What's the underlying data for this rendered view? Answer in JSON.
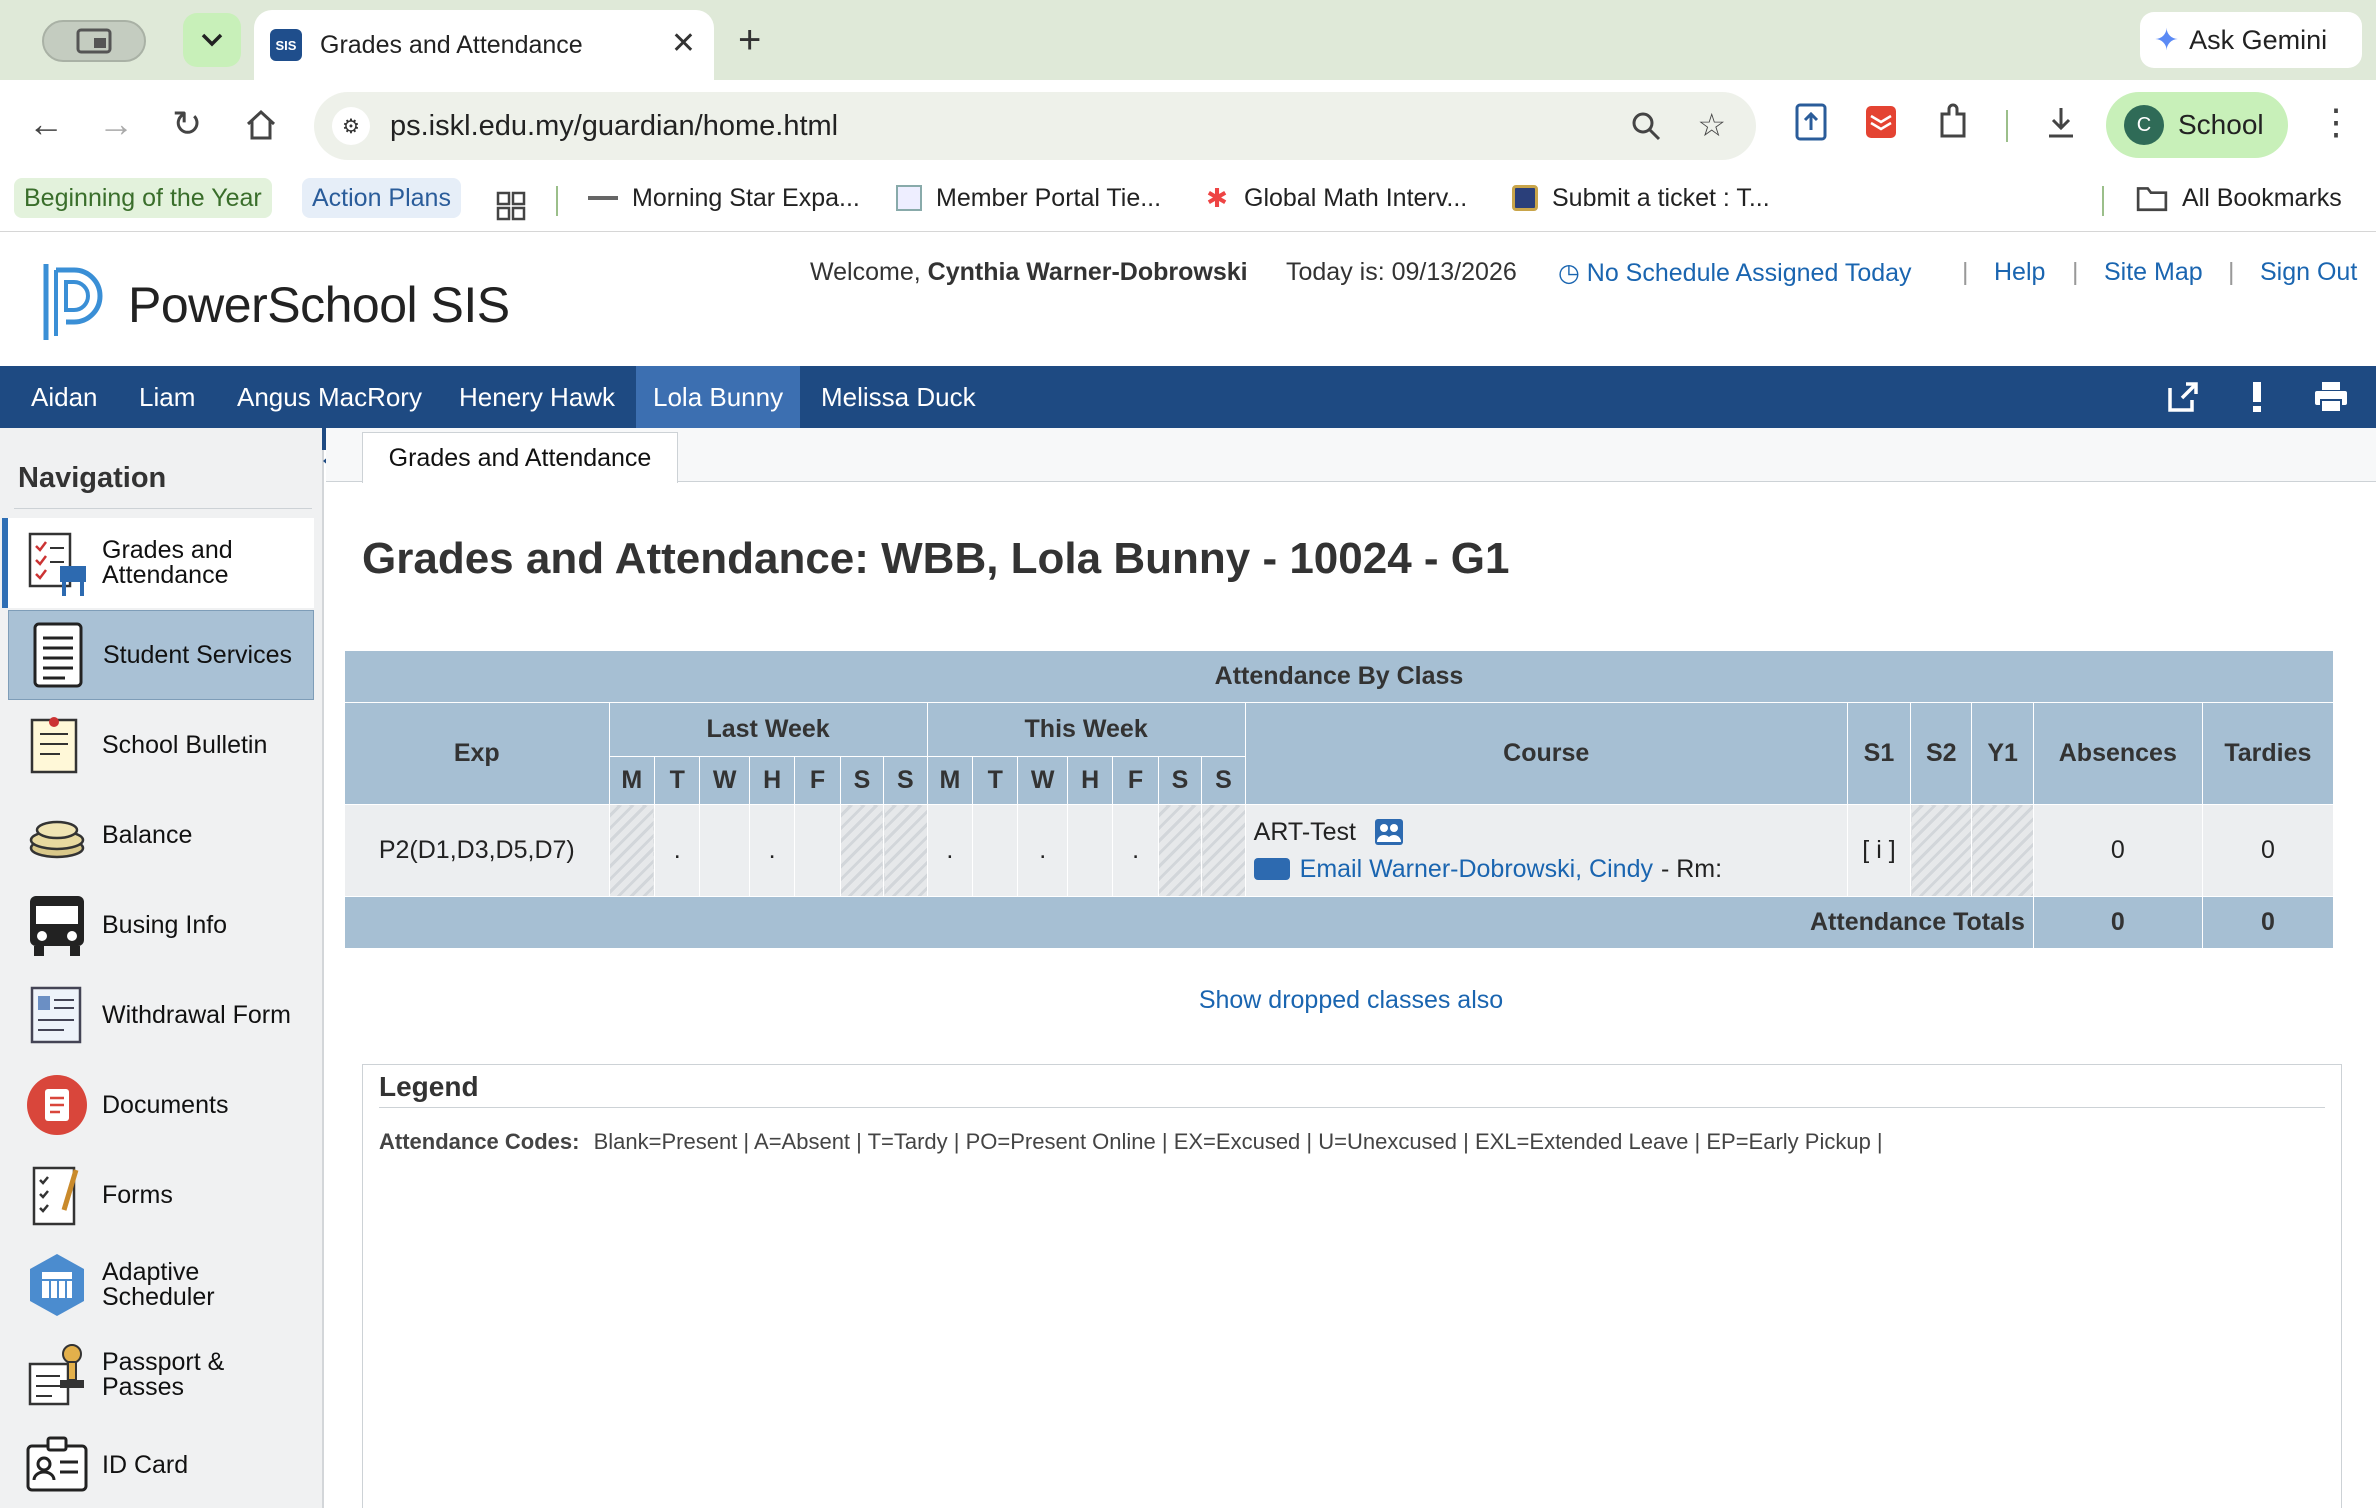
{
  "browser": {
    "tab_title": "Grades and Attendance",
    "tab_favicon": "SIS",
    "ask_gemini": "Ask Gemini",
    "url": "ps.iskl.edu.my/guardian/home.html",
    "profile_initial": "C",
    "profile_name": "School",
    "bookmarks": [
      "Beginning of the Year",
      "Action Plans",
      "Morning Star Expa...",
      "Member Portal Tie...",
      "Global Math Interv...",
      "Submit a ticket : T..."
    ],
    "all_bookmarks": "All Bookmarks"
  },
  "header": {
    "brand": "PowerSchool SIS",
    "welcome_prefix": "Welcome,",
    "user_name": "Cynthia Warner-Dobrowski",
    "today_label": "Today is:",
    "today_date": "09/13/2026",
    "schedule_link": "No Schedule Assigned Today",
    "help": "Help",
    "site_map": "Site Map",
    "sign_out": "Sign Out"
  },
  "students": [
    "Aidan",
    "Liam",
    "Angus MacRory",
    "Henery Hawk",
    "Lola Bunny",
    "Melissa Duck"
  ],
  "active_student": "Lola Bunny",
  "navigation": {
    "title": "Navigation",
    "items": [
      {
        "label": "Grades and Attendance",
        "icon": "gradebook-icon"
      },
      {
        "label": "Student Services",
        "icon": "document-list-icon"
      },
      {
        "label": "School Bulletin",
        "icon": "bulletin-icon"
      },
      {
        "label": "Balance",
        "icon": "coins-icon"
      },
      {
        "label": "Busing Info",
        "icon": "bus-icon"
      },
      {
        "label": "Withdrawal Form",
        "icon": "form-icon"
      },
      {
        "label": "Documents",
        "icon": "documents-icon"
      },
      {
        "label": "Forms",
        "icon": "checklist-icon"
      },
      {
        "label": "Adaptive Scheduler",
        "icon": "calendar-icon"
      },
      {
        "label": "Passport & Passes",
        "icon": "stamp-icon"
      },
      {
        "label": "ID Card",
        "icon": "id-card-icon"
      }
    ]
  },
  "content": {
    "tab_label": "Grades and Attendance",
    "page_title": "Grades and Attendance: WBB, Lola Bunny - 10024 - G1",
    "table": {
      "caption": "Attendance By Class",
      "headers": {
        "exp": "Exp",
        "last_week": "Last Week",
        "this_week": "This Week",
        "course": "Course",
        "s1": "S1",
        "s2": "S2",
        "y1": "Y1",
        "absences": "Absences",
        "tardies": "Tardies"
      },
      "days": [
        "M",
        "T",
        "W",
        "H",
        "F",
        "S",
        "S"
      ],
      "row": {
        "exp": "P2(D1,D3,D5,D7)",
        "last_week": [
          "",
          ".",
          "",
          ".",
          "",
          "",
          ""
        ],
        "this_week": [
          ".",
          "",
          ".",
          "",
          ".",
          "",
          ""
        ],
        "course": "ART-Test",
        "teacher_link": "Email Warner-Dobrowski, Cindy",
        "room": "- Rm:",
        "s1": "[ i ]",
        "absences": "0",
        "tardies": "0"
      },
      "totals": {
        "label": "Attendance Totals",
        "absences": "0",
        "tardies": "0"
      }
    },
    "show_dropped": "Show dropped classes also",
    "legend": {
      "title": "Legend",
      "codes_label": "Attendance Codes:",
      "codes": "Blank=Present | A=Absent | T=Tardy | PO=Present Online | EX=Excused | U=Unexcused | EXL=Extended Leave | EP=Early Pickup |"
    }
  }
}
